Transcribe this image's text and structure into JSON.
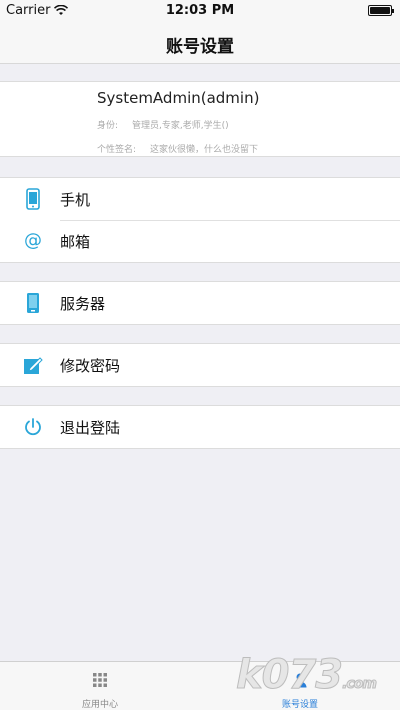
{
  "status": {
    "carrier": "Carrier",
    "time": "12:03 PM"
  },
  "nav": {
    "title": "账号设置"
  },
  "profile": {
    "name": "SystemAdmin(admin)",
    "role_label": "身份:",
    "role_value": "管理员,专家,老师,学生()",
    "signature_label": "个性签名:",
    "signature_value": "这家伙很懒，什么也没留下"
  },
  "menu": {
    "phone": "手机",
    "email": "邮箱",
    "server": "服务器",
    "change_password": "修改密码",
    "logout": "退出登陆"
  },
  "tabs": [
    {
      "label": "应用中心",
      "icon": "grid-icon"
    },
    {
      "label": "账号设置",
      "icon": "person-icon"
    }
  ],
  "watermark": {
    "text": "k073",
    "suffix": ".com"
  },
  "colors": {
    "accent": "#2aa6d8",
    "tab_active": "#2a7fd8"
  }
}
